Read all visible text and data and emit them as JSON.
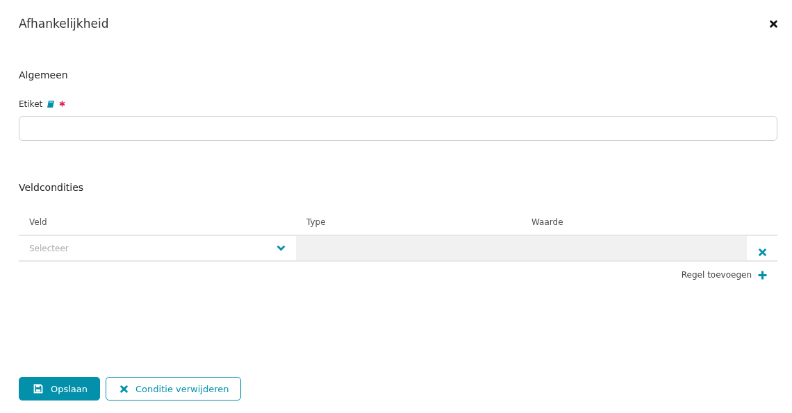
{
  "dialog": {
    "title": "Afhankelijkheid"
  },
  "general": {
    "heading": "Algemeen",
    "field": {
      "label": "Etiket",
      "required": true
    }
  },
  "conditions": {
    "heading": "Veldcondities",
    "columns": [
      "Veld",
      "Type",
      "Waarde"
    ],
    "rows": [
      {
        "field": {
          "placeholder": "Selecteer"
        }
      }
    ],
    "add_label": "Regel toevoegen"
  },
  "buttons": [
    {
      "label": "Opslaan",
      "kind": "primary"
    },
    {
      "label": "Conditie verwijderen",
      "kind": "outline"
    }
  ]
}
